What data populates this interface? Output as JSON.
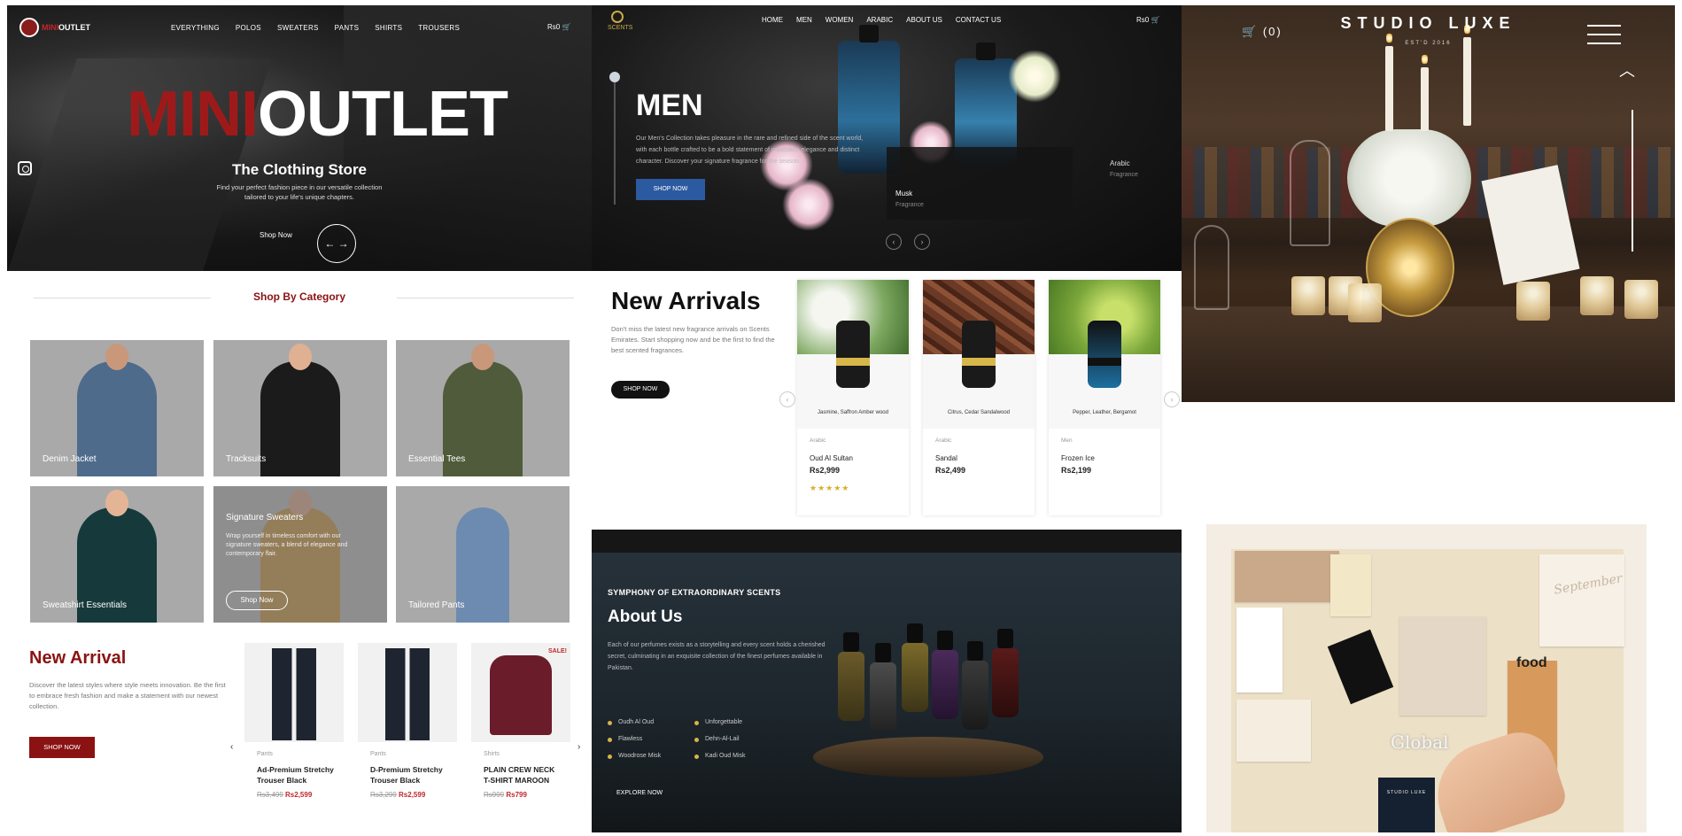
{
  "panel1": {
    "logo": {
      "brand_a": "MINI",
      "brand_b": "OUTLET"
    },
    "nav": [
      "EVERYTHING",
      "POLOS",
      "SWEATERS",
      "PANTS",
      "SHIRTS",
      "TROUSERS"
    ],
    "cart": "Rs0",
    "hero": {
      "title_red": "MINI",
      "title_white": "OUTLET",
      "subtitle": "The Clothing Store",
      "description": "Find your perfect fashion piece in our versatile collection tailored to your life's unique chapters.",
      "cta": "Shop Now",
      "arrows": "← →"
    },
    "category_heading": "Shop By Category",
    "categories": [
      {
        "label": "Denim Jacket"
      },
      {
        "label": "Tracksuits"
      },
      {
        "label": "Essential Tees"
      },
      {
        "label": "Sweatshirt Essentials"
      },
      {
        "label": "Signature Sweaters",
        "text": "Wrap yourself in timeless comfort with our signature sweaters, a blend of elegance and contemporary flair.",
        "button": "Shop Now"
      },
      {
        "label": "Tailored Pants"
      }
    ],
    "new_arrival": {
      "title": "New Arrival",
      "description": "Discover the latest styles where style meets innovation. Be the first to embrace fresh fashion and make a statement with our newest collection.",
      "button": "SHOP NOW"
    },
    "products": [
      {
        "category": "Pants",
        "name": "Ad-Premium Stretchy Trouser Black",
        "old_price": "Rs3,499",
        "price": "Rs2,599"
      },
      {
        "category": "Pants",
        "name": "D-Premium Stretchy Trouser Black",
        "old_price": "Rs3,299",
        "price": "Rs2,599"
      },
      {
        "category": "Shirts",
        "name": "PLAIN CREW NECK T-SHIRT MAROON",
        "old_price": "Rs999",
        "price": "Rs799",
        "badge": "SALE!"
      }
    ],
    "arrow_prev": "‹",
    "arrow_next": "›"
  },
  "panel2": {
    "logo": "SCENTS",
    "nav": [
      "HOME",
      "MEN",
      "WOMEN",
      "ARABIC",
      "ABOUT US",
      "CONTACT US"
    ],
    "cart": "Rs0",
    "hero": {
      "title": "MEN",
      "description": "Our Men's Collection takes pleasure in the rare and refined side of the scent world, with each bottle crafted to be a bold statement of masculine elegance and distinct character. Discover your signature fragrance for the season.",
      "button": "SHOP NOW",
      "card_title": "Musk",
      "card_sub": "Fragrance",
      "side_title": "Arabic",
      "side_sub": "Fragrance"
    },
    "pagination": [
      "‹",
      "›"
    ],
    "new_arrivals": {
      "title": "New Arrivals",
      "description": "Don't miss the latest new fragrance arrivals on Scents Emirates. Start shopping now and be the first to find the best scented fragrances.",
      "button": "SHOP NOW"
    },
    "products": [
      {
        "caption": "Jasmine, Saffron Amber wood",
        "category": "Arabic",
        "name": "Oud Al Sultan",
        "price": "Rs2,999",
        "stars": "★★★★★"
      },
      {
        "caption": "Citrus, Cedar Sandalwood",
        "category": "Arabic",
        "name": "Sandal",
        "price": "Rs2,499"
      },
      {
        "caption": "Pepper, Leather, Bergamot",
        "category": "Men",
        "name": "Frozen Ice",
        "price": "Rs2,199"
      }
    ],
    "carousel_prev": "‹",
    "carousel_next": "›",
    "about": {
      "kicker": "SYMPHONY OF EXTRAORDINARY SCENTS",
      "title": "About Us",
      "description": "Each of our perfumes exists as a storytelling and every scent holds a cherished secret, culminating in an exquisite collection of the finest perfumes available in Pakistan.",
      "notes": [
        "Oudh Al Oud",
        "Unforgettable",
        "Flawless",
        "Dehn-Al-Lail",
        "Woodrose Misk",
        "Kadi Oud Misk"
      ],
      "cta": "EXPLORE NOW"
    }
  },
  "panel3": {
    "brand": "STUDIO LUXE",
    "established": "EST'D 2016",
    "cart": "(0)",
    "scroll_up": "︿",
    "board": {
      "food_label": "food",
      "global_label": "Global",
      "signature": "September",
      "card_text": "STUDIO LUXE"
    }
  }
}
